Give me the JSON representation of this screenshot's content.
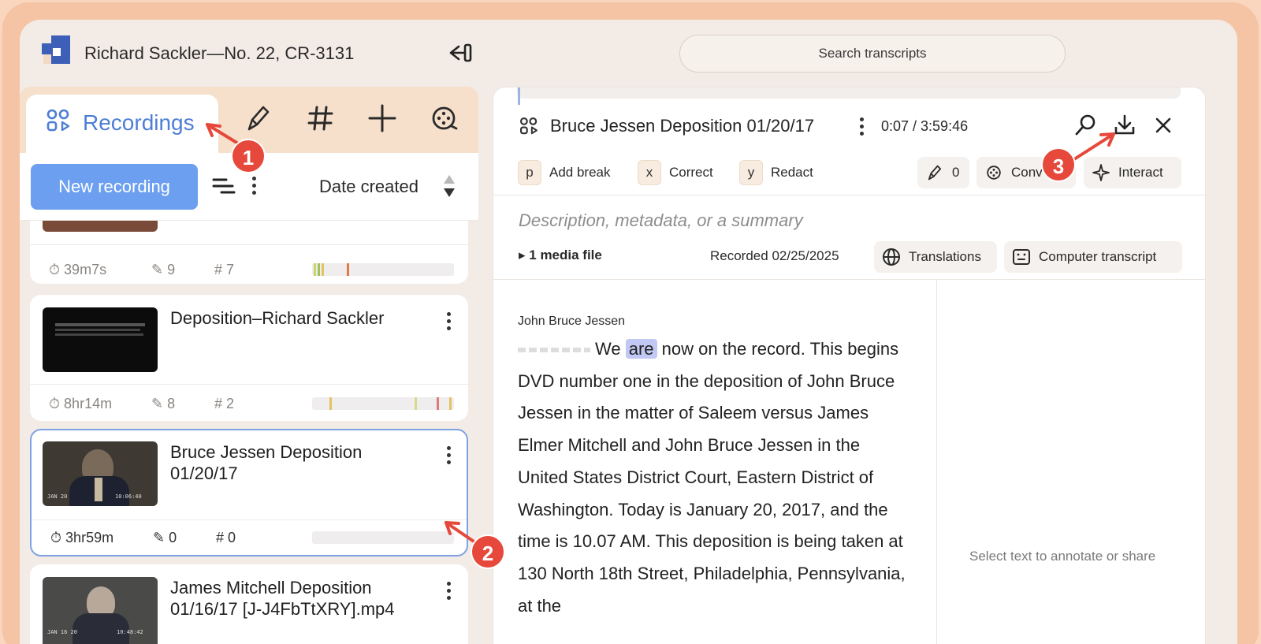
{
  "header": {
    "title": "Richard Sackler—No. 22, CR-3131",
    "search_placeholder": "Search transcripts"
  },
  "left": {
    "tabs": {
      "recordings": "Recordings"
    },
    "new_recording": "New recording",
    "sort_label": "Date created",
    "cards": [
      {
        "title": "",
        "duration": "39m7s",
        "highlights": "9",
        "tags": "# 7"
      },
      {
        "title": "Deposition–Richard Sackler",
        "duration": "8hr14m",
        "highlights": "8",
        "tags": "# 2"
      },
      {
        "title": "Bruce Jessen Deposition 01/20/17",
        "duration": "3hr59m",
        "highlights": "0",
        "tags": "# 0",
        "thumb_text": "JAN 20",
        "thumb_time": "10:06:40"
      },
      {
        "title": "James Mitchell Deposition 01/16/17 [J-J4FbTtXRY].mp4",
        "thumb_text": "JAN 16 20",
        "thumb_time": "10:48:42"
      }
    ]
  },
  "right": {
    "title": "Bruce Jessen Deposition 01/20/17",
    "time": "0:07 / 3:59:46",
    "shortcuts": [
      {
        "key": "p",
        "label": "Add break"
      },
      {
        "key": "x",
        "label": "Correct"
      },
      {
        "key": "y",
        "label": "Redact"
      }
    ],
    "highlight_count": "0",
    "conv_label": "Conv",
    "interact_label": "Interact",
    "description_placeholder": "Description, metadata, or a summary",
    "media_files": "1 media file",
    "recorded_label": "Recorded",
    "recorded_date": "02/25/2025",
    "translations": "Translations",
    "computer_transcript": "Computer transcript",
    "speaker": "John Bruce Jessen",
    "transcript_we": "We",
    "transcript_highlight": "are",
    "transcript_rest": "now on the record. This begins DVD number one in the deposition of John Bruce Jessen in the matter of Saleem versus James Elmer Mitchell and John Bruce Jessen in the United States District Court, Eastern District of Washington. Today is January 20, 2017, and the time is 10.07 AM. This deposition is being taken at 130 North 18th Street, Philadelphia, Pennsylvania, at the",
    "annotate_hint": "Select text to annotate or share"
  },
  "callouts": [
    "1",
    "2",
    "3"
  ],
  "colors": {
    "accent": "#6c9ff0",
    "callout": "#e6483b",
    "highlight": "#c2c8f4"
  }
}
